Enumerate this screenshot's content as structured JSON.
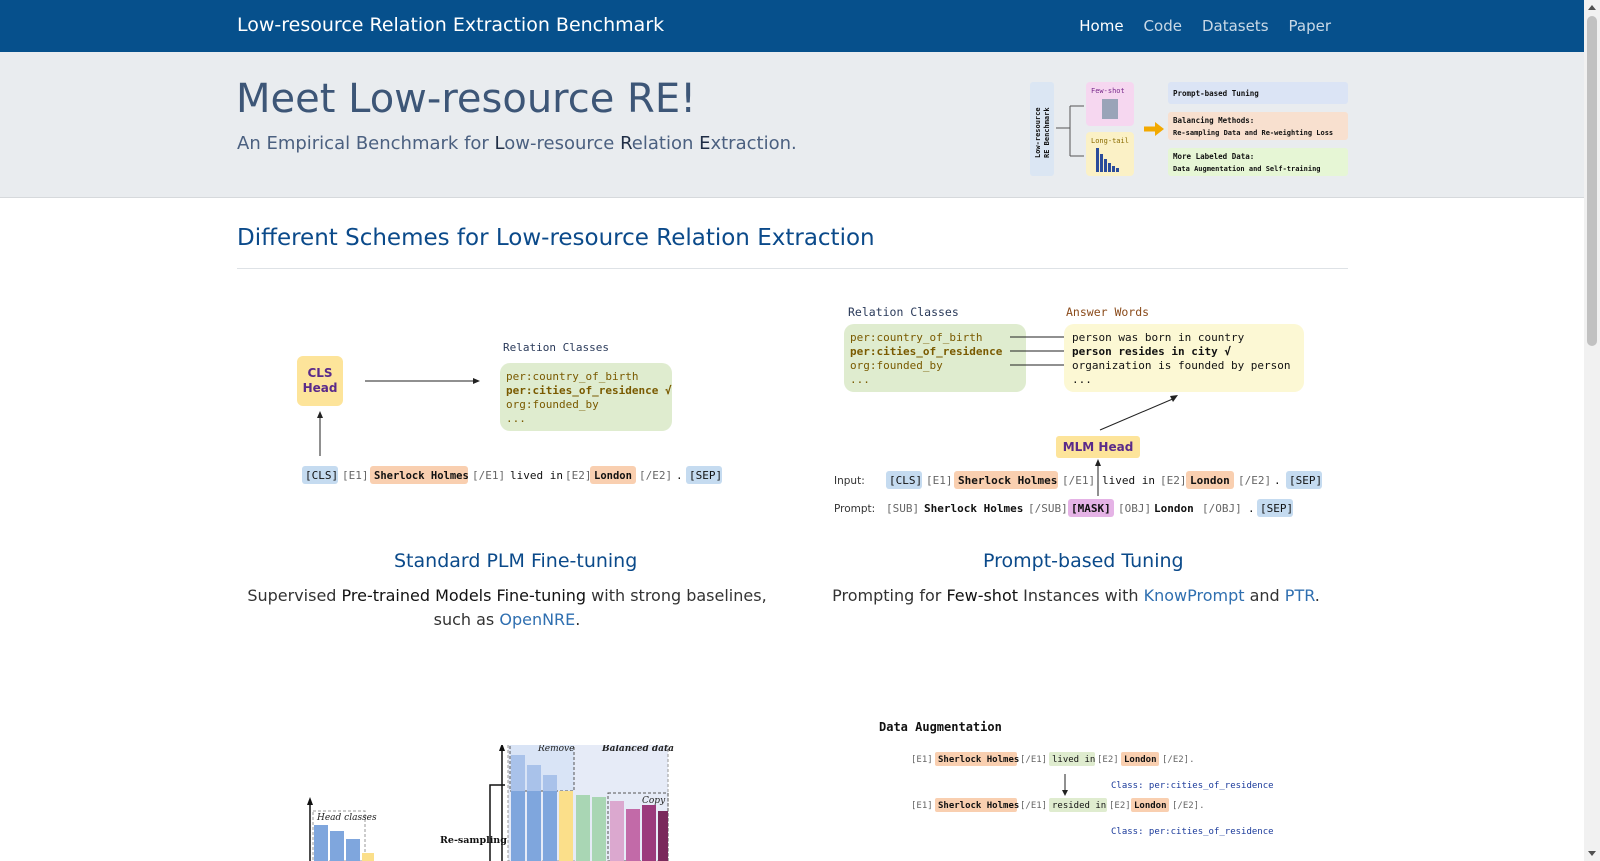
{
  "navbar": {
    "brand": "Low-resource Relation Extraction Benchmark",
    "links": [
      "Home",
      "Code",
      "Datasets",
      "Paper"
    ]
  },
  "hero": {
    "title": "Meet Low-resource RE!",
    "subtitle_parts": [
      "An Empirical Benchmark for ",
      "L",
      "ow-resource ",
      "R",
      "elation ",
      "E",
      "xtraction."
    ],
    "figure": {
      "root_label_1": "Low-resource",
      "root_label_2": "RE Benchmark",
      "few_shot": "Few-shot",
      "long_tail": "Long-tail",
      "box1": "Prompt-based Tuning",
      "box2_title": "Balancing Methods:",
      "box2_sub": "Re-sampling Data and Re-weighting Loss",
      "box3_title": "More Labeled Data:",
      "box3_sub": "Data Augmentation and Self-training"
    }
  },
  "section": {
    "title": "Different Schemes for Low-resource Relation Extraction"
  },
  "fig_standard": {
    "head": [
      "CLS",
      "Head"
    ],
    "relation_classes_title": "Relation Classes",
    "classes": [
      "per:country_of_birth",
      "per:cities_of_residence √",
      "org:founded_by",
      "..."
    ],
    "tokens": [
      "[CLS]",
      "[E1]",
      "Sherlock Holmes",
      "[/E1]",
      "lived in",
      "[E2]",
      "London",
      "[/E2]",
      ".",
      "[SEP]"
    ]
  },
  "fig_prompt": {
    "relation_classes_title": "Relation Classes",
    "answer_words_title": "Answer Words",
    "classes": [
      "per:country_of_birth",
      "per:cities_of_residence",
      "org:founded_by",
      "..."
    ],
    "answers": [
      "person was born in country",
      "person resides in city √",
      "organization is founded by person",
      "..."
    ],
    "mlm_head": "MLM Head",
    "input_label": "Input:",
    "prompt_label": "Prompt:",
    "input_tokens": [
      "[CLS]",
      "[E1]",
      "Sherlock Holmes",
      "[/E1]",
      "lived in",
      "[E2]",
      "London",
      "[/E2]",
      ".",
      "[SEP]"
    ],
    "prompt_tokens": [
      "[SUB]",
      "Sherlock Holmes",
      "[/SUB]",
      "[MASK]",
      "[OBJ]",
      "London",
      "[/OBJ]",
      ".",
      "[SEP]"
    ]
  },
  "captions": {
    "standard": {
      "title": "Standard PLM Fine-tuning",
      "text_1": "Supervised ",
      "text_strong": "Pre-trained Models Fine-tuning",
      "text_2": " with strong baselines,",
      "text_3": "such as ",
      "link": "OpenNRE",
      "text_4": "."
    },
    "prompt": {
      "title": "Prompt-based Tuning",
      "text_1": "Prompting for ",
      "text_strong": "Few-shot",
      "text_2": " Instances with ",
      "link_1": "KnowPrompt",
      "text_3": " and ",
      "link_2": "PTR",
      "text_4": "."
    }
  },
  "fig_balance": {
    "head_classes": "Head classes",
    "resampling": "Re-sampling",
    "remove": "Remove",
    "balanced": "Balanced data",
    "copy": "Copy"
  },
  "fig_aug": {
    "title": "Data Augmentation",
    "row1": [
      "[E1]",
      "Sherlock Holmes",
      "[/E1]",
      "lived in",
      "[E2]",
      "London",
      "[/E2]."
    ],
    "row2": [
      "[E1]",
      "Sherlock Holmes",
      "[/E1]",
      "resided in",
      "[E2]",
      "London",
      "[/E2]."
    ],
    "class_line": "Class: per:cities_of_residence"
  }
}
